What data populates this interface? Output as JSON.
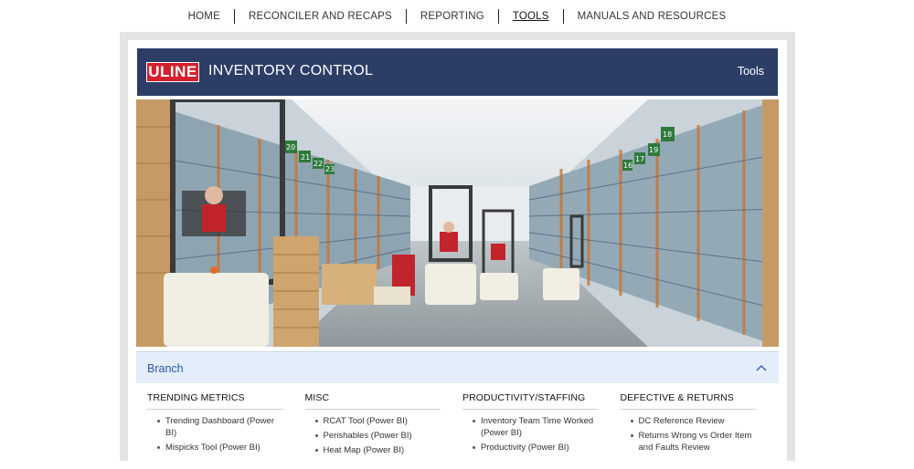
{
  "nav": {
    "items": [
      {
        "label": "HOME"
      },
      {
        "label": "RECONCILER AND RECAPS"
      },
      {
        "label": "REPORTING"
      },
      {
        "label": "TOOLS"
      },
      {
        "label": "MANUALS AND RESOURCES"
      }
    ],
    "active": "TOOLS"
  },
  "header": {
    "logo_text": "ULINE",
    "title": "INVENTORY CONTROL",
    "page": "Tools"
  },
  "colors": {
    "banner": "#2c3e66",
    "logo": "#d3202c",
    "accordion_bg": "#e4eefb",
    "accordion_text": "#2b56a7"
  },
  "section": {
    "title": "Branch",
    "expanded_icon": "chevron-up-icon",
    "columns": [
      {
        "heading": "TRENDING METRICS",
        "links": [
          "Trending Dashboard (Power BI)",
          "Mispicks Tool (Power BI)"
        ]
      },
      {
        "heading": "MISC",
        "links": [
          "RCAT Tool (Power BI)",
          "Perishables (Power BI)",
          "Heat Map (Power BI)"
        ]
      },
      {
        "heading": "PRODUCTIVITY/STAFFING",
        "links": [
          "Inventory Team Time Worked (Power BI)",
          "Productivity (Power BI)"
        ]
      },
      {
        "heading": "DEFECTIVE & RETURNS",
        "links": [
          "DC Reference Review",
          "Returns Wrong vs Order Item and Faults Review"
        ]
      }
    ]
  },
  "hero_signs": [
    "20",
    "21",
    "22",
    "23",
    "16",
    "17",
    "18",
    "19",
    "20",
    "21"
  ]
}
